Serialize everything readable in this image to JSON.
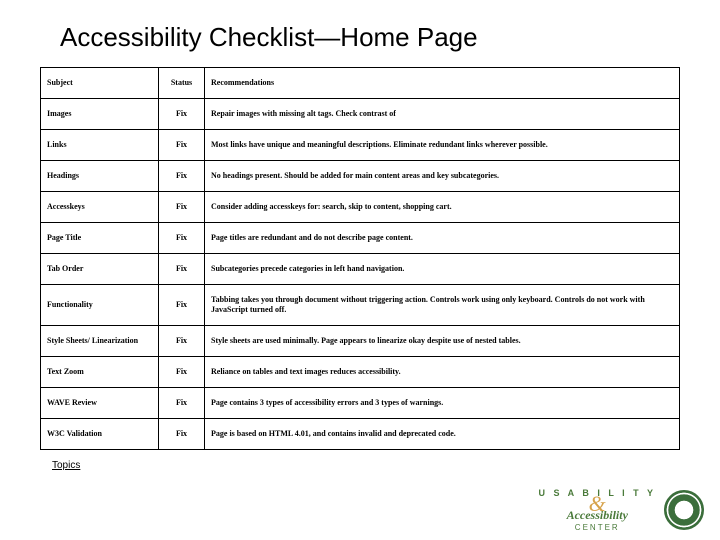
{
  "title": "Accessibility Checklist—Home Page",
  "columns": {
    "subject": "Subject",
    "status": "Status",
    "rec": "Recommendations"
  },
  "rows": [
    {
      "subject": "Images",
      "status": "Fix",
      "rec": "Repair images with missing alt tags. Check contrast of"
    },
    {
      "subject": "Links",
      "status": "Fix",
      "rec": "Most links have unique and meaningful descriptions. Eliminate redundant links wherever possible."
    },
    {
      "subject": "Headings",
      "status": "Fix",
      "rec": "No headings present. Should be added for main content areas and key subcategories."
    },
    {
      "subject": "Accesskeys",
      "status": "Fix",
      "rec": "Consider adding accesskeys for: search, skip to content, shopping cart."
    },
    {
      "subject": "Page Title",
      "status": "Fix",
      "rec": "Page titles are redundant and do not describe page content."
    },
    {
      "subject": "Tab Order",
      "status": "Fix",
      "rec": "Subcategories precede categories in left hand navigation."
    },
    {
      "subject": "Functionality",
      "status": "Fix",
      "rec": "Tabbing takes you through document without triggering action. Controls work using only keyboard. Controls do not work with JavaScript turned off."
    },
    {
      "subject": "Style Sheets/ Linearization",
      "status": "Fix",
      "rec": "Style sheets are used minimally. Page appears to linearize okay despite use of nested tables."
    },
    {
      "subject": "Text Zoom",
      "status": "Fix",
      "rec": "Reliance on tables and text images reduces accessibility."
    },
    {
      "subject": "WAVE Review",
      "status": "Fix",
      "rec": "Page contains 3 types of accessibility errors and 3 types of warnings."
    },
    {
      "subject": "W3C Validation",
      "status": "Fix",
      "rec": "Page is based on HTML 4.01, and contains invalid and deprecated code."
    }
  ],
  "topics_link": "Topics",
  "brand": {
    "usability": "U S A B I L I T Y",
    "amp": "&",
    "accessibility": "Accessibility",
    "center": "CENTER"
  }
}
